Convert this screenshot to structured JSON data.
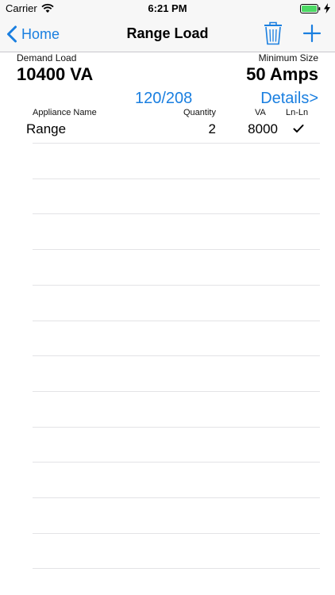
{
  "status_bar": {
    "carrier": "Carrier",
    "time": "6:21 PM"
  },
  "nav": {
    "back_label": "Home",
    "title": "Range Load"
  },
  "summary": {
    "demand_load_label": "Demand Load",
    "demand_load_value": "10400 VA",
    "minimum_size_label": "Minimum Size",
    "minimum_size_value": "50 Amps",
    "voltage": "120/208",
    "details_link": "Details>"
  },
  "table": {
    "headers": {
      "appliance_name": "Appliance Name",
      "quantity": "Quantity",
      "va": "VA",
      "ln_ln": "Ln-Ln"
    },
    "rows": [
      {
        "name": "Range",
        "quantity": "2",
        "va": "8000",
        "ln_ln": true
      }
    ]
  },
  "colors": {
    "accent": "#1a7fe0",
    "separator": "#e3e3e6",
    "bar_background": "#f7f7f7"
  }
}
